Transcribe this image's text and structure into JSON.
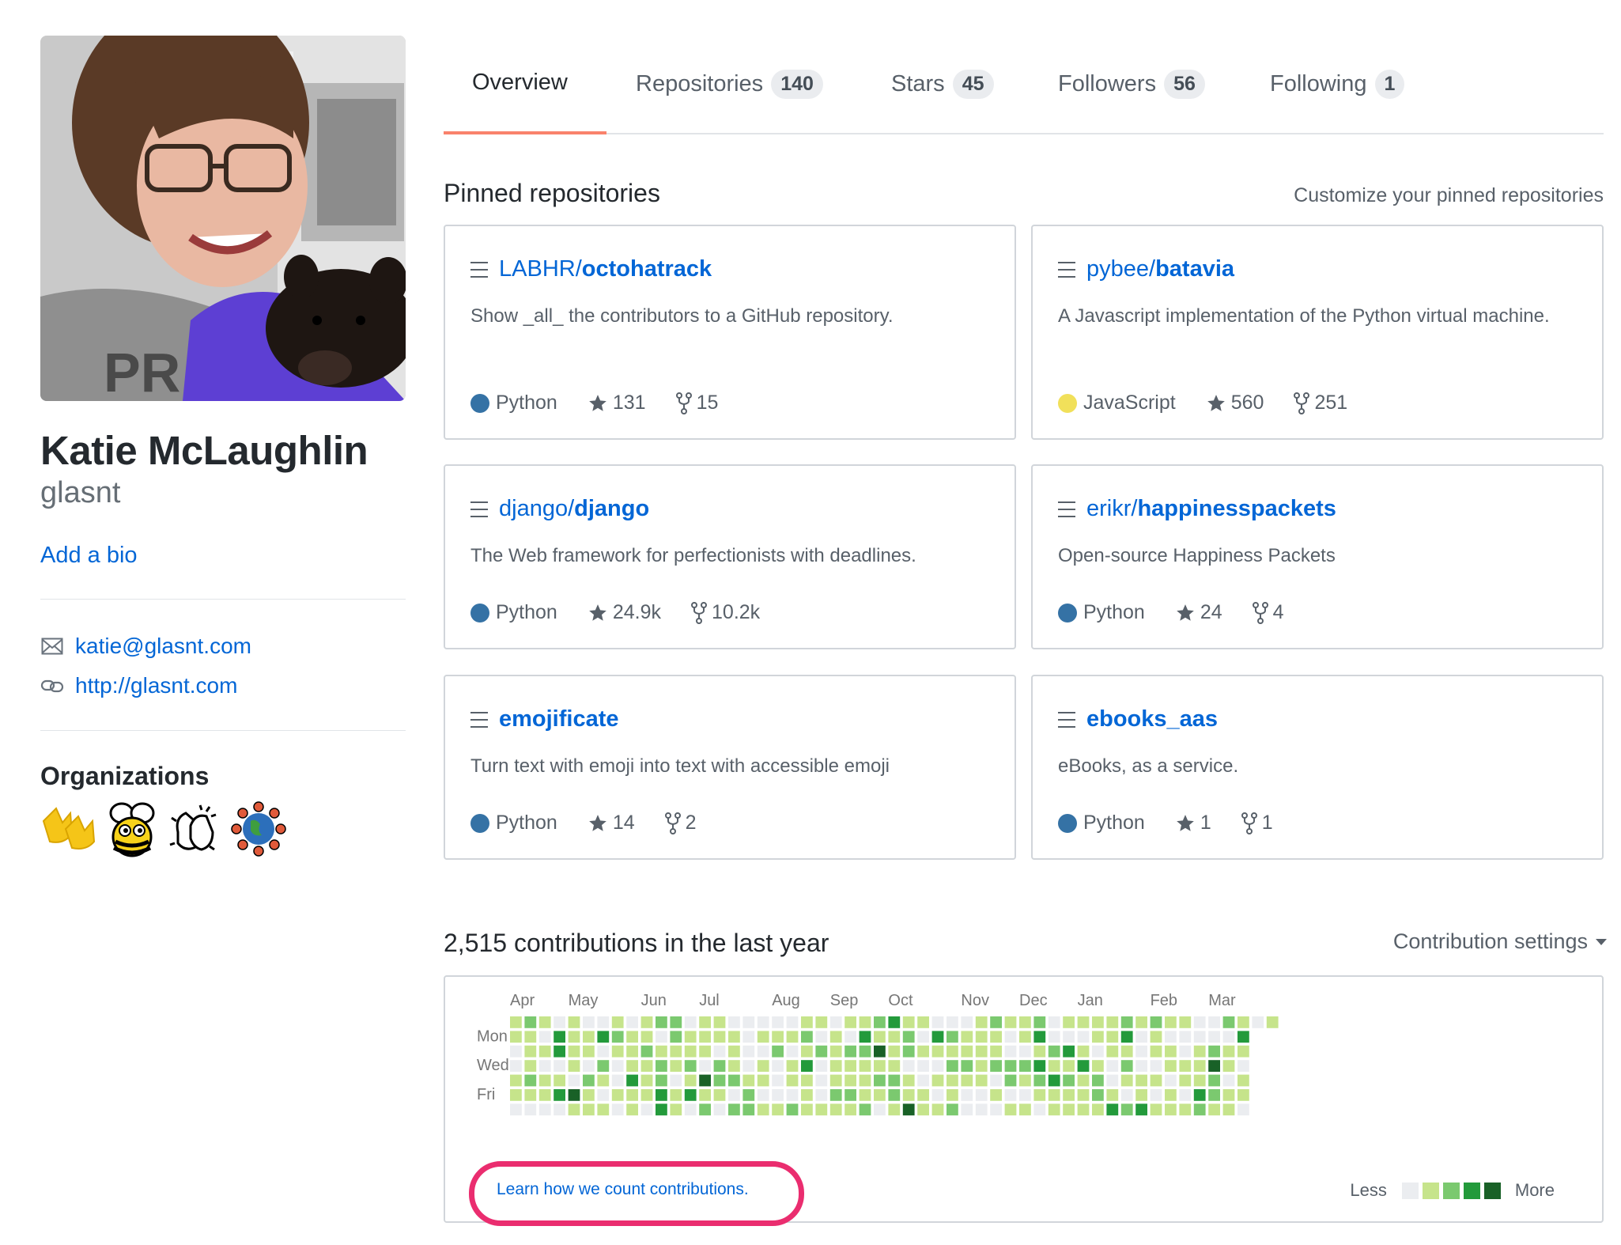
{
  "profile": {
    "name": "Katie McLaughlin",
    "username": "glasnt",
    "add_bio": "Add a bio",
    "email": "katie@glasnt.com",
    "website": "http://glasnt.com",
    "organizations_heading": "Organizations",
    "organizations": [
      {
        "icon": "yellow-duck-feet-icon"
      },
      {
        "icon": "beeware-bee-icon"
      },
      {
        "icon": "clapping-hands-icon"
      },
      {
        "icon": "globe-people-circle-icon"
      }
    ]
  },
  "nav": {
    "tabs": [
      {
        "label": "Overview",
        "count": ""
      },
      {
        "label": "Repositories",
        "count": "140"
      },
      {
        "label": "Stars",
        "count": "45"
      },
      {
        "label": "Followers",
        "count": "56"
      },
      {
        "label": "Following",
        "count": "1"
      }
    ],
    "active_tab": "Overview",
    "active_color": "#f9826c"
  },
  "pinned": {
    "heading": "Pinned repositories",
    "customize": "Customize your pinned repositories",
    "repos": [
      {
        "owner": "LABHR/",
        "name": "octohatrack",
        "description": "Show _all_ the contributors to a GitHub repository.",
        "language": "Python",
        "lang_color": "#3572A5",
        "stars": "131",
        "forks": "15"
      },
      {
        "owner": "pybee/",
        "name": "batavia",
        "description": "A Javascript implementation of the Python virtual machine.",
        "language": "JavaScript",
        "lang_color": "#f1e05a",
        "stars": "560",
        "forks": "251"
      },
      {
        "owner": "django/",
        "name": "django",
        "description": "The Web framework for perfectionists with deadlines.",
        "language": "Python",
        "lang_color": "#3572A5",
        "stars": "24.9k",
        "forks": "10.2k"
      },
      {
        "owner": "erikr/",
        "name": "happinesspackets",
        "description": "Open-source Happiness Packets",
        "language": "Python",
        "lang_color": "#3572A5",
        "stars": "24",
        "forks": "4"
      },
      {
        "owner": "",
        "name": "emojificate",
        "description": "Turn text with emoji into text with accessible emoji",
        "language": "Python",
        "lang_color": "#3572A5",
        "stars": "14",
        "forks": "2"
      },
      {
        "owner": "",
        "name": "ebooks_aas",
        "description": "eBooks, as a service.",
        "language": "Python",
        "lang_color": "#3572A5",
        "stars": "1",
        "forks": "1"
      }
    ]
  },
  "contributions": {
    "heading": "2,515 contributions in the last year",
    "settings": "Contribution settings",
    "months": [
      "Apr",
      "May",
      "Jun",
      "Jul",
      "Aug",
      "Sep",
      "Oct",
      "Nov",
      "Dec",
      "Jan",
      "Feb",
      "Mar"
    ],
    "day_labels": [
      "Mon",
      "Wed",
      "Fri"
    ],
    "learn_link": "Learn how we count contributions.",
    "legend_less": "Less",
    "legend_more": "More",
    "level_colors": [
      "#ebedf0",
      "#c6e48b",
      "#7bc96f",
      "#239a3b",
      "#196127"
    ],
    "highlight_color": "#ea2d6f"
  }
}
